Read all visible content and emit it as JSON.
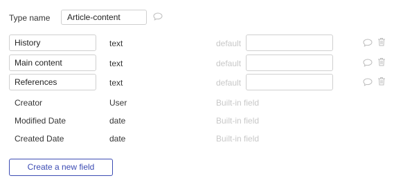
{
  "type": {
    "label": "Type name",
    "value": "Article-content"
  },
  "fields": [
    {
      "name": "History",
      "type": "text",
      "default_label": "default",
      "default_value": ""
    },
    {
      "name": "Main content",
      "type": "text",
      "default_label": "default",
      "default_value": ""
    },
    {
      "name": "References",
      "type": "text",
      "default_label": "default",
      "default_value": ""
    }
  ],
  "builtin_fields": [
    {
      "name": "Creator",
      "type": "User",
      "note": "Built-in field"
    },
    {
      "name": "Modified Date",
      "type": "date",
      "note": "Built-in field"
    },
    {
      "name": "Created Date",
      "type": "date",
      "note": "Built-in field"
    }
  ],
  "actions": {
    "create_label": "Create a new field"
  },
  "icons": {
    "comment": "speech-bubble-icon",
    "delete": "trash-icon"
  },
  "colors": {
    "accent": "#3b4bb3",
    "muted": "#c8c8c8",
    "border": "#cfcfcf"
  }
}
